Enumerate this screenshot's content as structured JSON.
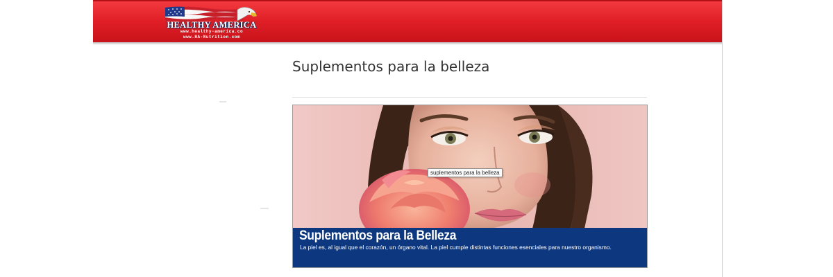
{
  "header": {
    "logo": {
      "brand": "HEALTHY AMERICA",
      "url_primary": "www.healthy-america.co",
      "url_secondary": "www.HA-Nutrition.com"
    },
    "colors": {
      "header_red": "#e11f27",
      "caption_blue": "#0d3880"
    }
  },
  "page": {
    "title": "Suplementos para la belleza"
  },
  "banner": {
    "tooltip": "suplementos para la belleza",
    "caption_title": "Suplementos para la Belleza",
    "caption_text": "La piel es, al igual que el corazón, un órgano vital. La piel cumple distintas funciones esenciales para nuestro organismo."
  }
}
